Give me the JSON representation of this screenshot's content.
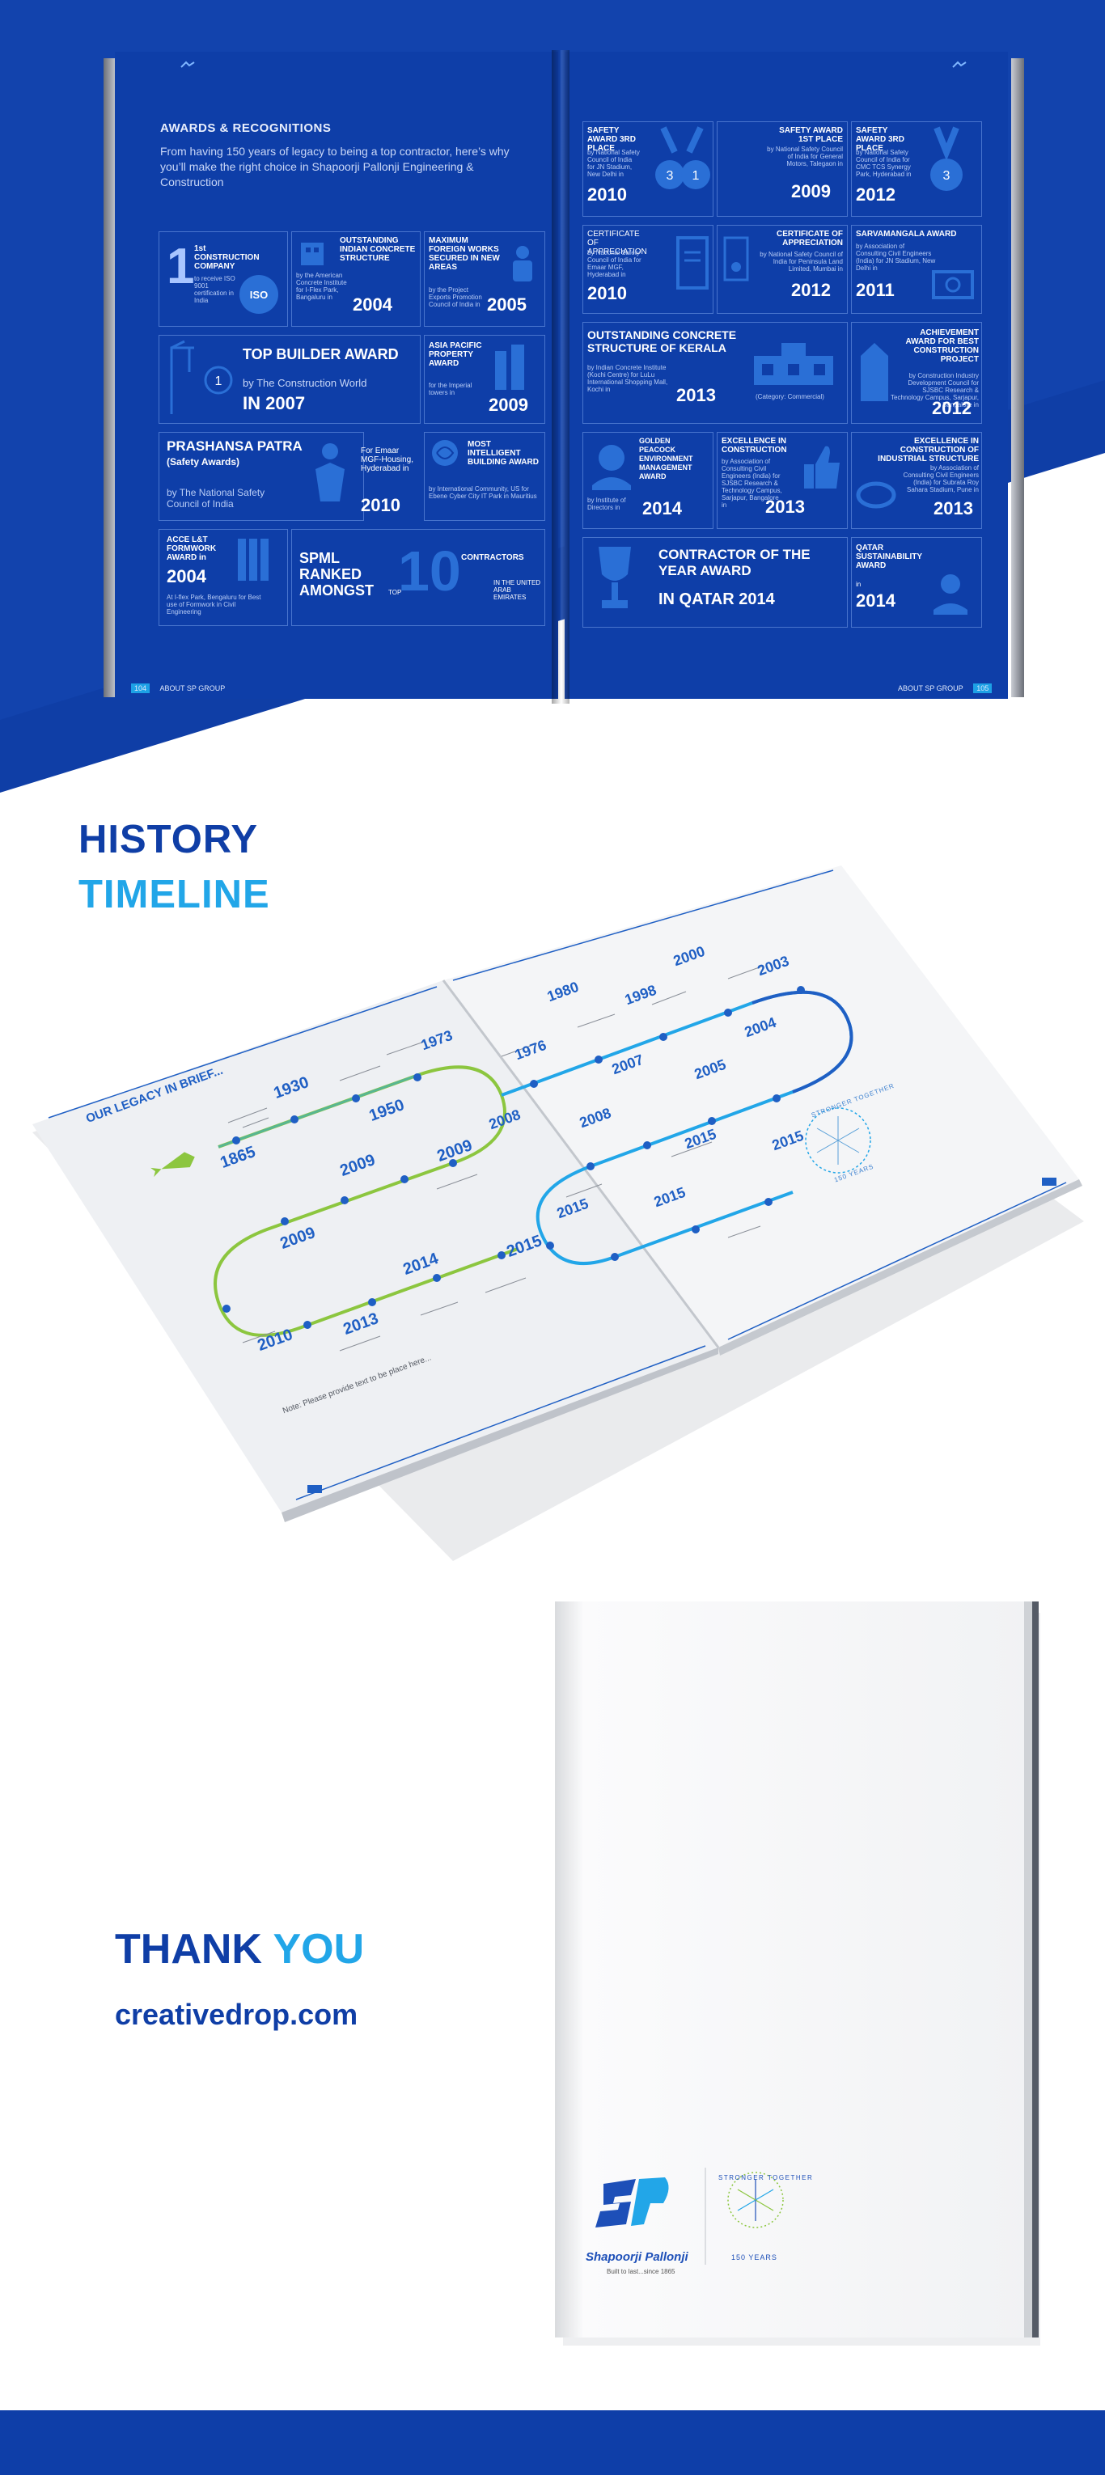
{
  "awards_section": {
    "title": "AWARDS & RECOGNITIONS",
    "intro": "From having 150 years of legacy to being a top contractor, here’s why you’ll make the right choice in Shapoorji Pallonji Engineering & Construction",
    "left_cards": [
      {
        "title": "1st CONSTRUCTION COMPANY",
        "desc": "to receive ISO 9001 certification in India"
      },
      {
        "title": "OUTSTANDING INDIAN CONCRETE STRUCTURE",
        "desc": "by the American Concrete Institute for I-Flex Park, Bangaluru in",
        "year": "2004"
      },
      {
        "title": "MAXIMUM FOREIGN WORKS SECURED IN NEW AREAS",
        "desc": "by the Project Exports Promotion Council of India in",
        "year": "2005"
      },
      {
        "title": "TOP BUILDER AWARD",
        "desc": "by The Construction World",
        "year": "IN 2007"
      },
      {
        "title": "ASIA PACIFIC PROPERTY AWARD",
        "desc": "for the Imperial towers in",
        "year": "2009"
      },
      {
        "title": "PRASHANSA PATRA",
        "sub": "(Safety Awards)",
        "desc": "by The National Safety Council of India"
      },
      {
        "title": "For Emaar MGF-Housing, Hyderabad in",
        "year": "2010"
      },
      {
        "title": "MOST INTELLIGENT BUILDING AWARD",
        "desc": "by International Community, US for Ebene Cyber City IT Park in Mauritius"
      },
      {
        "title": "ACCE L&T FORMWORK AWARD in",
        "desc": "At I-flex Park, Bengaluru for Best use of Formwork in Civil Engineering",
        "year": "2004"
      },
      {
        "title": "SPML RANKED AMONGST",
        "top": "TOP",
        "ten": "10",
        "desc": "CONTRACTORS",
        "desc2": "IN THE UNITED ARAB EMIRATES"
      }
    ],
    "right_cards": [
      {
        "title": "SAFETY AWARD 3RD PLACE",
        "desc": "by National Safety Council of India for JN Stadium, New Delhi in",
        "year": "2010"
      },
      {
        "title": "SAFETY AWARD 1ST PLACE",
        "desc": "by National Safety Council of India for General Motors, Talegaon in",
        "year": "2009"
      },
      {
        "title": "SAFETY AWARD 3RD PLACE",
        "desc": "by National Safety Council of India for CMC TCS Synergy Park, Hyderabad in",
        "year": "2012"
      },
      {
        "title": "CERTIFICATE OF APPRECIATION",
        "desc": "by National Safety Council of India for Emaar MGF, Hyderabad in",
        "year": "2010"
      },
      {
        "title": "CERTIFICATE OF APPRECIATION",
        "desc": "by National Safety Council of India for Peninsula Land Limited, Mumbai in",
        "year": "2012"
      },
      {
        "title": "SARVAMANGALA AWARD",
        "desc": "by Association of Consulting Civil Engineers (India) for JN Stadium, New Delhi in",
        "year": "2011"
      },
      {
        "title": "OUTSTANDING CONCRETE STRUCTURE OF KERALA",
        "desc": "by Indian Concrete Institute (Kochi Centre) for LuLu International Shopping Mall, Kochi in",
        "year": "2013",
        "cat": "(Category: Commercial)"
      },
      {
        "title": "ACHIEVEMENT AWARD FOR BEST CONSTRUCTION PROJECT",
        "desc": "by Construction Industry Development Council for SJSBC Research & Technology Campus, Sarjapur, Bangalore in",
        "year": "2012"
      },
      {
        "title": "GOLDEN PEACOCK ENVIRONMENT MANAGEMENT AWARD",
        "desc": "by Institute of Directors in",
        "year": "2014"
      },
      {
        "title": "EXCELLENCE IN CONSTRUCTION",
        "desc": "by Association of Consulting Civil Engineers (India) for SJSBC Research & Technology Campus, Sarjapur, Bangalore in",
        "year": "2013"
      },
      {
        "title": "EXCELLENCE IN CONSTRUCTION OF INDUSTRIAL STRUCTURE",
        "desc": "by Association of Consulting Civil Engineers (India) for Subrata Roy Sahara Stadium, Pune in",
        "year": "2013"
      },
      {
        "title": "CONTRACTOR OF THE YEAR AWARD",
        "year": "IN QATAR 2014"
      },
      {
        "title": "QATAR SUSTAINABILITY AWARD",
        "desc": "in",
        "year": "2014"
      }
    ],
    "footer_left": "ABOUT SP GROUP",
    "page_left": "104",
    "footer_right": "ABOUT SP GROUP",
    "page_right": "105"
  },
  "history": {
    "title_line1": "HISTORY",
    "title_line2": "TIMELINE",
    "legacy_title": "OUR LEGACY IN BRIEF...",
    "note": "Note: Please provide text to be place here...",
    "years_left": [
      "1865",
      "1930",
      "1950",
      "1973",
      "2009",
      "2009",
      "2008",
      "2009",
      "2010",
      "2013",
      "2014",
      "2015",
      "2015"
    ],
    "years_right": [
      "1976",
      "1980",
      "1998",
      "2000",
      "2003",
      "2004",
      "2005",
      "2007",
      "2008",
      "2015",
      "2015",
      "2015"
    ],
    "badge_text": "STRONGER TOGETHER",
    "badge_years": "150 YEARS"
  },
  "closing": {
    "thank": "THANK",
    "you": "YOU",
    "website": "creativedrop.com"
  },
  "cover": {
    "brand": "Shapoorji Pallonji",
    "tagline": "Built to last...since 1865",
    "badge_text": "STRONGER TOGETHER",
    "badge_years": "150 YEARS"
  },
  "colors": {
    "page_blue": "#0e3ea8",
    "accent_cyan": "#22a6e8",
    "timeline_green": "#8cc63f"
  }
}
